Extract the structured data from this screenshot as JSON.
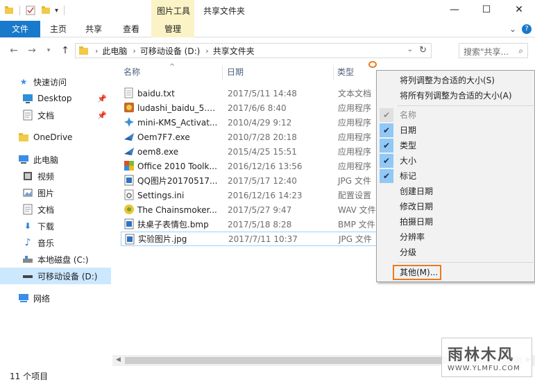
{
  "window": {
    "tool_tab_label": "图片工具",
    "title": "共享文件夹",
    "minimize_glyph": "—",
    "maximize_glyph": "☐",
    "close_glyph": "✕"
  },
  "ribbon": {
    "tabs": [
      "文件",
      "主页",
      "共享",
      "查看",
      "管理"
    ],
    "expand_glyph": "⌄",
    "help_glyph": "?"
  },
  "address": {
    "crumbs": [
      "此电脑",
      "可移动设备 (D:)",
      "共享文件夹"
    ],
    "search_placeholder": "搜索\"共享...",
    "search_icon": "search-icon"
  },
  "sidebar": {
    "quick_access": "快速访问",
    "items": [
      {
        "label": "快速访问",
        "icon": "star-icon",
        "color": "#3a8ee6"
      },
      {
        "label": "Desktop",
        "icon": "desktop-icon",
        "color": "#2f8fd8",
        "pinned": true
      },
      {
        "label": "文档",
        "icon": "document-icon",
        "color": "#6a6a6a",
        "pinned": true
      },
      {
        "label": "OneDrive",
        "icon": "folder-icon",
        "color": "#f3c94a"
      },
      {
        "label": "此电脑",
        "icon": "computer-icon",
        "color": "#3a8ee6"
      },
      {
        "label": "视频",
        "icon": "video-icon",
        "color": "#555555"
      },
      {
        "label": "图片",
        "icon": "picture-icon",
        "color": "#555555"
      },
      {
        "label": "文档",
        "icon": "document-icon",
        "color": "#555555"
      },
      {
        "label": "下载",
        "icon": "download-icon",
        "color": "#2f7fd8"
      },
      {
        "label": "音乐",
        "icon": "music-icon",
        "color": "#2f7fd8"
      },
      {
        "label": "本地磁盘 (C:)",
        "icon": "drive-icon",
        "color": "#555555"
      },
      {
        "label": "可移动设备 (D:)",
        "icon": "usb-drive-icon",
        "color": "#555555",
        "selected": true
      },
      {
        "label": "网络",
        "icon": "network-icon",
        "color": "#3a8ee6"
      }
    ]
  },
  "columns": {
    "name": "名称",
    "date": "日期",
    "type": "类型",
    "sort_glyph": "^"
  },
  "files": [
    {
      "name": "baidu.txt",
      "date": "2017/5/11 14:48",
      "type": "文本文档",
      "icon": "text-file-icon"
    },
    {
      "name": "ludashi_baidu_5.1...",
      "date": "2017/6/6 8:40",
      "type": "应用程序",
      "icon": "app-icon"
    },
    {
      "name": "mini-KMS_Activat...",
      "date": "2010/4/29 9:12",
      "type": "应用程序",
      "icon": "app-icon"
    },
    {
      "name": "Oem7F7.exe",
      "date": "2010/7/28 20:18",
      "type": "应用程序",
      "icon": "app-icon"
    },
    {
      "name": "oem8.exe",
      "date": "2015/4/25 15:51",
      "type": "应用程序",
      "icon": "app-icon"
    },
    {
      "name": "Office 2010 Toolk...",
      "date": "2016/12/16 13:56",
      "type": "应用程序",
      "icon": "app-icon"
    },
    {
      "name": "QQ图片20170517...",
      "date": "2017/5/17 12:40",
      "type": "JPG 文件",
      "icon": "image-file-icon"
    },
    {
      "name": "Settings.ini",
      "date": "2016/12/16 14:23",
      "type": "配置设置",
      "icon": "settings-file-icon"
    },
    {
      "name": "The Chainsmoker...",
      "date": "2017/5/27 9:47",
      "type": "WAV 文件",
      "icon": "audio-file-icon"
    },
    {
      "name": "扶桌子表情包.bmp",
      "date": "2017/5/18 8:28",
      "type": "BMP 文件",
      "icon": "image-file-icon"
    },
    {
      "name": "实验图片.jpg",
      "date": "2017/7/11 10:37",
      "type": "JPG 文件",
      "icon": "image-file-icon",
      "selected": true
    }
  ],
  "context_menu": {
    "top_items": [
      "将列调整为合适的大小(S)",
      "将所有列调整为合适的大小(A)"
    ],
    "check_items": [
      {
        "label": "名称",
        "checked": true,
        "disabled": true
      },
      {
        "label": "日期",
        "checked": true
      },
      {
        "label": "类型",
        "checked": true
      },
      {
        "label": "大小",
        "checked": true
      },
      {
        "label": "标记",
        "checked": true
      },
      {
        "label": "创建日期",
        "checked": false
      },
      {
        "label": "修改日期",
        "checked": false
      },
      {
        "label": "拍摄日期",
        "checked": false
      },
      {
        "label": "分辨率",
        "checked": false
      },
      {
        "label": "分级",
        "checked": false
      }
    ],
    "other": "其他(M)...",
    "check_glyph": "✔"
  },
  "status": {
    "count": "11 个项目"
  },
  "watermark": {
    "title": "雨林木风",
    "url": "WWW.YLMFU.COM"
  },
  "colors": {
    "accent": "#1979ca",
    "highlight": "#e87a21",
    "tool_tab": "#fbf3c6",
    "selection": "#cce8ff"
  }
}
